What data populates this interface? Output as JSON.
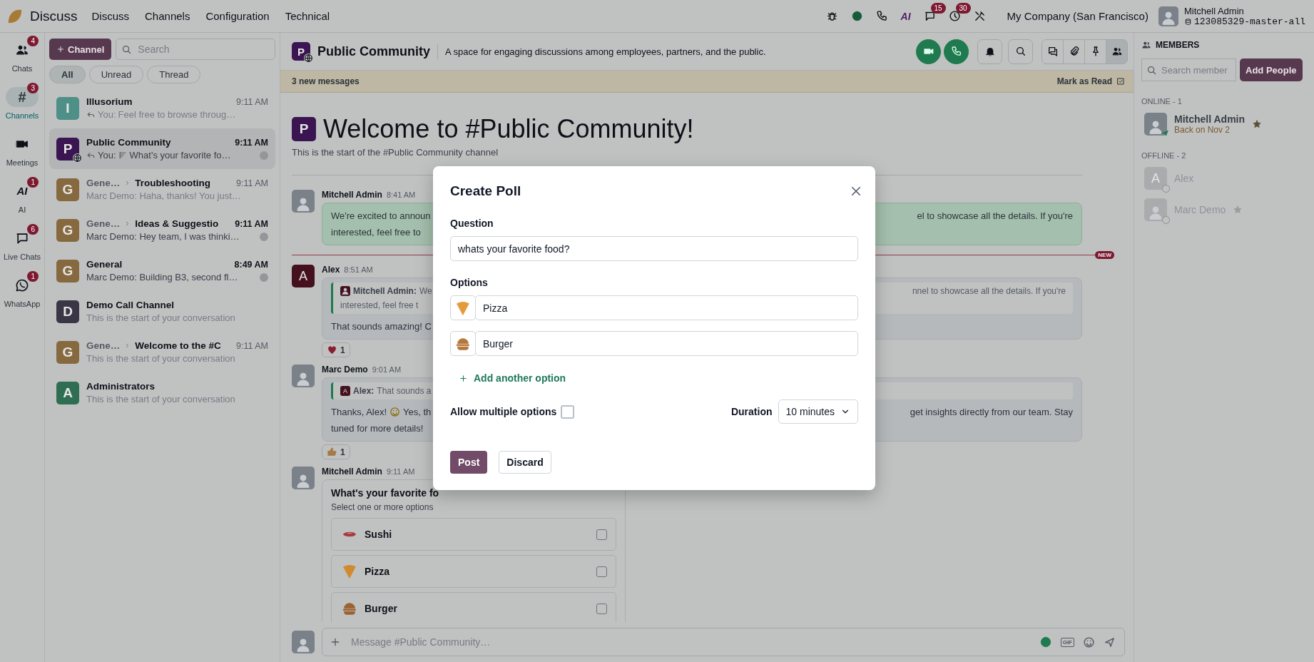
{
  "topbar": {
    "app_name": "Discuss",
    "menu": [
      "Discuss",
      "Channels",
      "Configuration",
      "Technical"
    ],
    "systray": [
      {
        "kind": "bug"
      },
      {
        "kind": "status"
      },
      {
        "kind": "phone"
      },
      {
        "kind": "ai",
        "glyph": "AI"
      },
      {
        "kind": "chat",
        "badge": "15"
      },
      {
        "kind": "clock",
        "badge": "30"
      },
      {
        "kind": "tools"
      }
    ],
    "company": "My Company (San Francisco)",
    "user": {
      "name": "Mitchell Admin",
      "database": "123085329-master-all"
    }
  },
  "nav": [
    {
      "kind": "people",
      "label": "Chats",
      "badge": "4",
      "selected": false
    },
    {
      "kind": "hash",
      "glyph": "#",
      "label": "Channels",
      "badge": "3",
      "selected": true
    },
    {
      "kind": "video",
      "label": "Meetings",
      "selected": false
    },
    {
      "kind": "ai",
      "glyph": "AI",
      "label": "AI",
      "badge": "1",
      "selected": false
    },
    {
      "kind": "chat",
      "label": "Live Chats",
      "badge": "6",
      "selected": false
    },
    {
      "kind": "whatsapp",
      "label": "WhatsApp",
      "badge": "1",
      "selected": false
    }
  ],
  "channel_list": {
    "new_button": "Channel",
    "search": {
      "placeholder": "Search"
    },
    "filters": [
      {
        "label": "All",
        "selected": true
      },
      {
        "label": "Unread",
        "selected": false
      },
      {
        "label": "Thread",
        "selected": false
      }
    ],
    "items": [
      {
        "letter": "I",
        "color": "#4e8f87",
        "name": "Illusorium",
        "time": "9:11 AM",
        "preview": "Feel free to browse throug…",
        "author": "You:",
        "reply": true,
        "poll": false,
        "unread": false,
        "selected": false,
        "public": false
      },
      {
        "letter": "P",
        "color": "#3a1552",
        "name": "Public Community",
        "time": "9:11 AM",
        "preview": "What's your favorite fo…",
        "author": "You:",
        "reply": true,
        "poll": true,
        "unread": true,
        "selected": true,
        "public": true
      },
      {
        "letter": "G",
        "color": "#86693f",
        "parent": "Gene…",
        "name": "Troubleshooting",
        "time": "9:11 AM",
        "preview": "Marc Demo: Haha, thanks! You just…",
        "reply": false,
        "poll": false,
        "unread": false,
        "selected": false,
        "public": false
      },
      {
        "letter": "G",
        "color": "#86693f",
        "parent": "Gene…",
        "name": "Ideas & Suggestio",
        "time": "9:11 AM",
        "preview": "Marc Demo: Hey team, I was thinki…",
        "reply": false,
        "poll": false,
        "unread": true,
        "selected": false,
        "public": false
      },
      {
        "letter": "G",
        "color": "#86693f",
        "name": "General",
        "time": "8:49 AM",
        "preview": "Marc Demo: Building B3, second fl…",
        "reply": false,
        "poll": false,
        "unread": true,
        "selected": false,
        "public": false
      },
      {
        "letter": "D",
        "color": "#3b3645",
        "name": "Demo Call Channel",
        "preview": "This is the start of your conversation",
        "reply": false,
        "poll": false,
        "unread": false,
        "selected": false,
        "public": false
      },
      {
        "letter": "G",
        "color": "#86693f",
        "parent": "Gene…",
        "name": "Welcome to the #C",
        "time": "9:11 AM",
        "preview": "This is the start of your conversation",
        "reply": false,
        "poll": false,
        "unread": false,
        "selected": false,
        "public": false
      },
      {
        "letter": "A",
        "color": "#2f6e52",
        "name": "Administrators",
        "preview": "This is the start of your conversation",
        "reply": false,
        "poll": false,
        "unread": false,
        "selected": false,
        "public": false
      }
    ]
  },
  "chat": {
    "letter": "P",
    "name": "Public Community",
    "description": "A space for engaging discussions among employees, partners, and the public.",
    "actions": [
      {
        "kind": "video",
        "selected": false
      },
      {
        "kind": "phone",
        "selected": false
      },
      {
        "kind": "bell",
        "selected": false
      },
      {
        "kind": "search",
        "selected": false
      },
      {
        "kind": "threads",
        "selected": false
      },
      {
        "kind": "paperclip",
        "selected": false
      },
      {
        "kind": "pin",
        "selected": false
      },
      {
        "kind": "people",
        "selected": true
      }
    ],
    "banner": {
      "text": "3 new messages",
      "action": "Mark as Read"
    },
    "welcome": {
      "letter": "P",
      "title": "Welcome to #Public Community!",
      "subtitle": "This is the start of the #Public Community channel"
    },
    "new_marker": "NEW",
    "messages": [
      {
        "author": "Mitchell Admin",
        "time": "8:41 AM",
        "own": true,
        "lines": [
          {
            "left": "We're excited to announ",
            "right": "el to showcase all the details. If you're"
          },
          {
            "left": "interested, feel free to"
          }
        ]
      },
      {
        "author": "Alex",
        "time": "8:51 AM",
        "own": false,
        "letter": "A",
        "quote": {
          "author": "Mitchell Admin:",
          "lines": [
            {
              "left": "We",
              "right": "nnel to showcase all the details. If you're"
            },
            {
              "left": "interested, feel free t"
            }
          ]
        },
        "lines": [
          {
            "left": "That sounds amazing! C"
          }
        ],
        "reaction": {
          "kind": "heart",
          "count": "1"
        }
      },
      {
        "author": "Marc Demo",
        "time": "9:01 AM",
        "own": false,
        "quote": {
          "author": "Alex:",
          "letter": "A",
          "lines": [
            {
              "left": "That sounds a"
            }
          ]
        },
        "lines": [
          {
            "left": "Thanks, Alex!",
            "left2": "Yes, th",
            "right": "get insights directly from our team. Stay"
          },
          {
            "left": "tuned for more details!"
          }
        ],
        "reaction": {
          "kind": "thumbs",
          "count": "1"
        }
      },
      {
        "author": "Mitchell Admin",
        "time": "9:11 AM",
        "poll": {
          "title": "What's your favorite fo",
          "hint": "Select one or more options",
          "options": [
            {
              "kind": "sushi",
              "label": "Sushi",
              "checked": false
            },
            {
              "kind": "pizza",
              "label": "Pizza",
              "checked": false
            },
            {
              "kind": "burger",
              "label": "Burger",
              "checked": false
            }
          ]
        }
      }
    ],
    "composer": {
      "placeholder": "Message #Public Community…",
      "gif": "GIF"
    }
  },
  "members": {
    "title": "MEMBERS",
    "search": {
      "placeholder": "Search member"
    },
    "add_button": "Add People",
    "groups": [
      {
        "label": "ONLINE - 1",
        "members": [
          {
            "name": "Mitchell Admin",
            "status": "Back on Nov 2",
            "online": true,
            "starred": true
          }
        ]
      },
      {
        "label": "OFFLINE - 2",
        "members": [
          {
            "name": "Alex",
            "online": false,
            "starred": false,
            "letter": "A"
          },
          {
            "name": "Marc Demo",
            "online": false,
            "starred": true
          }
        ]
      }
    ]
  },
  "dialog": {
    "title": "Create Poll",
    "question_label": "Question",
    "question": "whats your favorite food?",
    "options_label": "Options",
    "options": [
      {
        "kind": "pizza",
        "value": "Pizza"
      },
      {
        "kind": "burger",
        "value": "Burger"
      }
    ],
    "add_option": "Add another option",
    "multiple_label": "Allow multiple options",
    "multiple_checked": false,
    "duration_label": "Duration",
    "duration": "10 minutes",
    "post": "Post",
    "discard": "Discard"
  }
}
